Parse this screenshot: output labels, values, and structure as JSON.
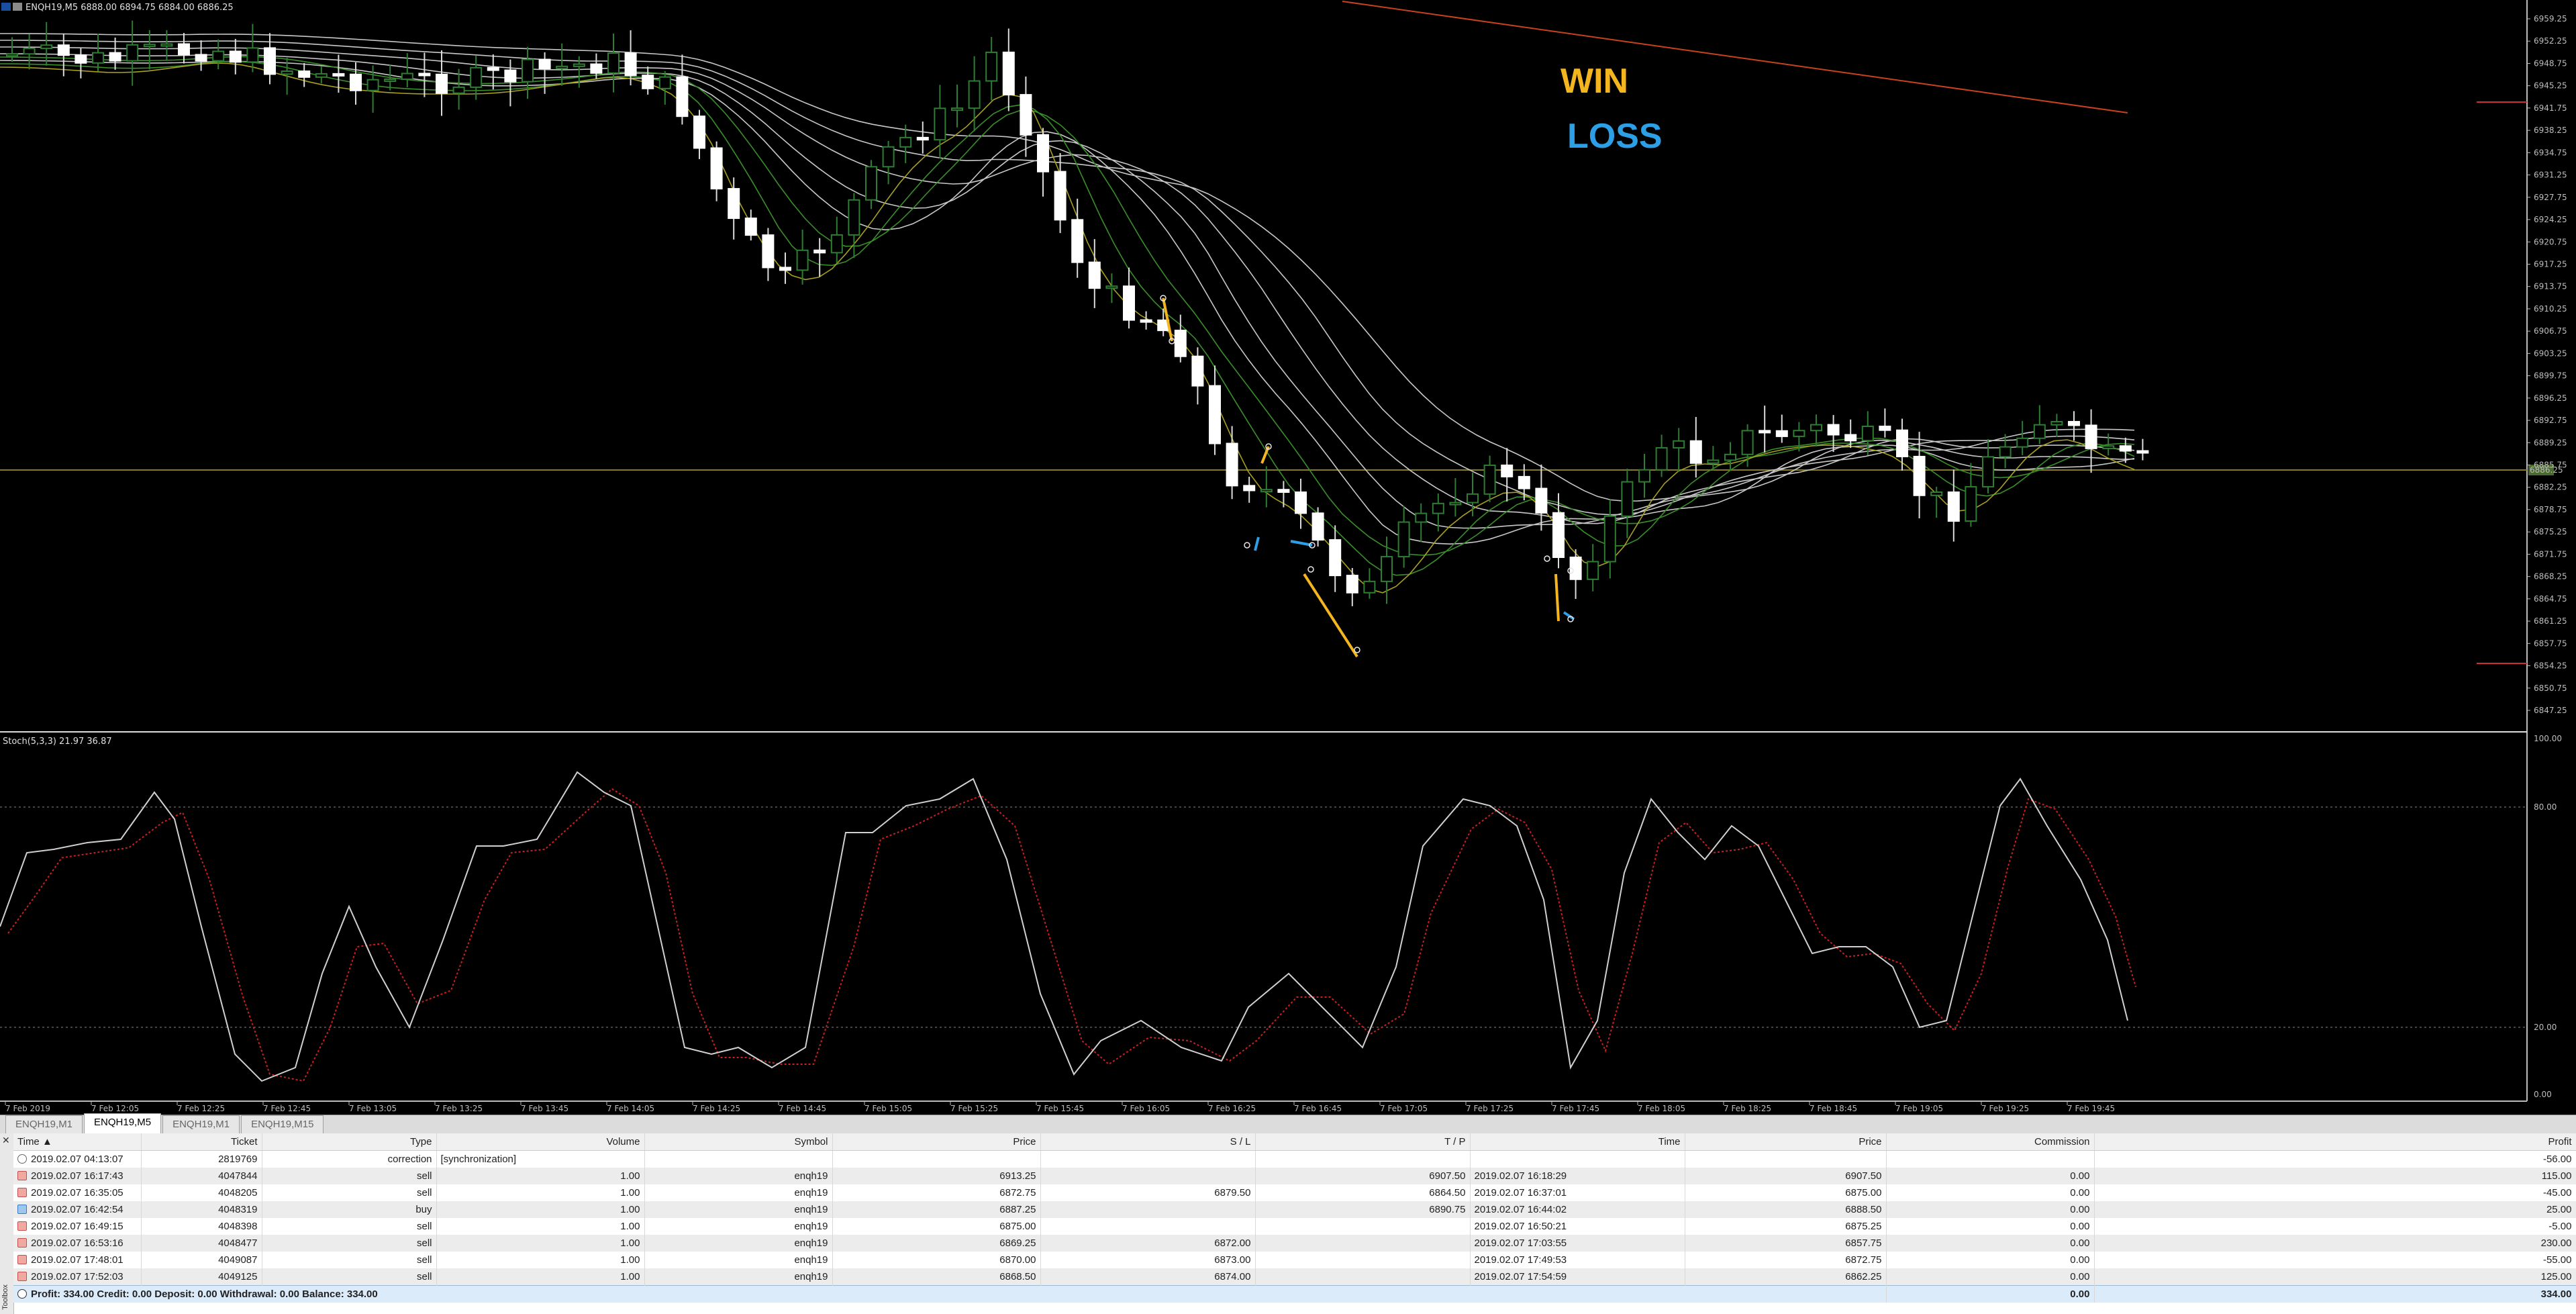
{
  "chart": {
    "title": "ENQH19,M5 6888.00 6894.75 6884.00 6886.25",
    "current_price": "6886.25",
    "price_labels": [
      "6959.25",
      "6952.25",
      "6948.75",
      "6945.25",
      "6941.75",
      "6938.25",
      "6934.75",
      "6931.25",
      "6927.75",
      "6924.25",
      "6920.75",
      "6917.25",
      "6913.75",
      "6910.25",
      "6906.75",
      "6903.25",
      "6899.75",
      "6896.25",
      "6892.75",
      "6889.25",
      "6885.75",
      "6882.25",
      "6878.75",
      "6875.25",
      "6871.75",
      "6868.25",
      "6864.75",
      "6861.25",
      "6857.75",
      "6854.25",
      "6850.75",
      "6847.25"
    ],
    "time_labels": [
      "7 Feb 2019",
      "7 Feb 12:05",
      "7 Feb 12:25",
      "7 Feb 12:45",
      "7 Feb 13:05",
      "7 Feb 13:25",
      "7 Feb 13:45",
      "7 Feb 14:05",
      "7 Feb 14:25",
      "7 Feb 14:45",
      "7 Feb 15:05",
      "7 Feb 15:25",
      "7 Feb 15:45",
      "7 Feb 16:05",
      "7 Feb 16:25",
      "7 Feb 16:45",
      "7 Feb 17:05",
      "7 Feb 17:25",
      "7 Feb 17:45",
      "7 Feb 18:05",
      "7 Feb 18:25",
      "7 Feb 18:45",
      "7 Feb 19:05",
      "7 Feb 19:25",
      "7 Feb 19:45"
    ],
    "win_label": "WIN",
    "loss_label": "LOSS",
    "colors": {
      "win": "#f5b51f",
      "loss": "#2d9fe6",
      "bull": "#2e7d32",
      "bear": "#ffffff",
      "ma_grey": "#c8c8c8",
      "ma_green": "#3a8f2a",
      "ma_yellow": "#a8a020",
      "trend": "#c8421f",
      "stoch_main": "#d0d0d0",
      "stoch_signal": "#cc2020"
    }
  },
  "stoch": {
    "title": "Stoch(5,3,3) 21.97 36.87",
    "levels": [
      "100.00",
      "80.00",
      "20.00",
      "0.00"
    ]
  },
  "tabs": [
    "ENQH19,M1",
    "ENQH19,M5",
    "ENQH19,M1",
    "ENQH19,M15"
  ],
  "active_tab": 1,
  "terminal": {
    "side_label": "Toolbox",
    "headers": {
      "time": "Time",
      "ticket": "Ticket",
      "type": "Type",
      "volume": "Volume",
      "symbol": "Symbol",
      "price": "Price",
      "sl": "S / L",
      "tp": "T / P",
      "time2": "Time",
      "price2": "Price",
      "commission": "Commission",
      "profit": "Profit"
    },
    "rows": [
      {
        "kind": "corr",
        "time": "2019.02.07 04:13:07",
        "ticket": "2819769",
        "type": "correction",
        "volume": "[synchronization]",
        "symbol": "",
        "price": "",
        "sl": "",
        "tp": "",
        "time2": "",
        "price2": "",
        "commission": "",
        "profit": "-56.00"
      },
      {
        "kind": "sell",
        "time": "2019.02.07 16:17:43",
        "ticket": "4047844",
        "type": "sell",
        "volume": "1.00",
        "symbol": "enqh19",
        "price": "6913.25",
        "sl": "",
        "tp": "6907.50",
        "time2": "2019.02.07 16:18:29",
        "price2": "6907.50",
        "commission": "0.00",
        "profit": "115.00"
      },
      {
        "kind": "sell",
        "time": "2019.02.07 16:35:05",
        "ticket": "4048205",
        "type": "sell",
        "volume": "1.00",
        "symbol": "enqh19",
        "price": "6872.75",
        "sl": "6879.50",
        "tp": "6864.50",
        "time2": "2019.02.07 16:37:01",
        "price2": "6875.00",
        "commission": "0.00",
        "profit": "-45.00"
      },
      {
        "kind": "buy",
        "time": "2019.02.07 16:42:54",
        "ticket": "4048319",
        "type": "buy",
        "volume": "1.00",
        "symbol": "enqh19",
        "price": "6887.25",
        "sl": "",
        "tp": "6890.75",
        "time2": "2019.02.07 16:44:02",
        "price2": "6888.50",
        "commission": "0.00",
        "profit": "25.00"
      },
      {
        "kind": "sell",
        "time": "2019.02.07 16:49:15",
        "ticket": "4048398",
        "type": "sell",
        "volume": "1.00",
        "symbol": "enqh19",
        "price": "6875.00",
        "sl": "",
        "tp": "",
        "time2": "2019.02.07 16:50:21",
        "price2": "6875.25",
        "commission": "0.00",
        "profit": "-5.00"
      },
      {
        "kind": "sell",
        "time": "2019.02.07 16:53:16",
        "ticket": "4048477",
        "type": "sell",
        "volume": "1.00",
        "symbol": "enqh19",
        "price": "6869.25",
        "sl": "6872.00",
        "tp": "",
        "time2": "2019.02.07 17:03:55",
        "price2": "6857.75",
        "commission": "0.00",
        "profit": "230.00"
      },
      {
        "kind": "sell",
        "time": "2019.02.07 17:48:01",
        "ticket": "4049087",
        "type": "sell",
        "volume": "1.00",
        "symbol": "enqh19",
        "price": "6870.00",
        "sl": "6873.00",
        "tp": "",
        "time2": "2019.02.07 17:49:53",
        "price2": "6872.75",
        "commission": "0.00",
        "profit": "-55.00"
      },
      {
        "kind": "sell",
        "time": "2019.02.07 17:52:03",
        "ticket": "4049125",
        "type": "sell",
        "volume": "1.00",
        "symbol": "enqh19",
        "price": "6868.50",
        "sl": "6874.00",
        "tp": "",
        "time2": "2019.02.07 17:54:59",
        "price2": "6862.25",
        "commission": "0.00",
        "profit": "125.00"
      }
    ],
    "summary": {
      "text": "Profit: 334.00  Credit: 0.00  Deposit: 0.00  Withdrawal: 0.00  Balance: 334.00",
      "commission": "0.00",
      "profit": "334.00"
    }
  }
}
